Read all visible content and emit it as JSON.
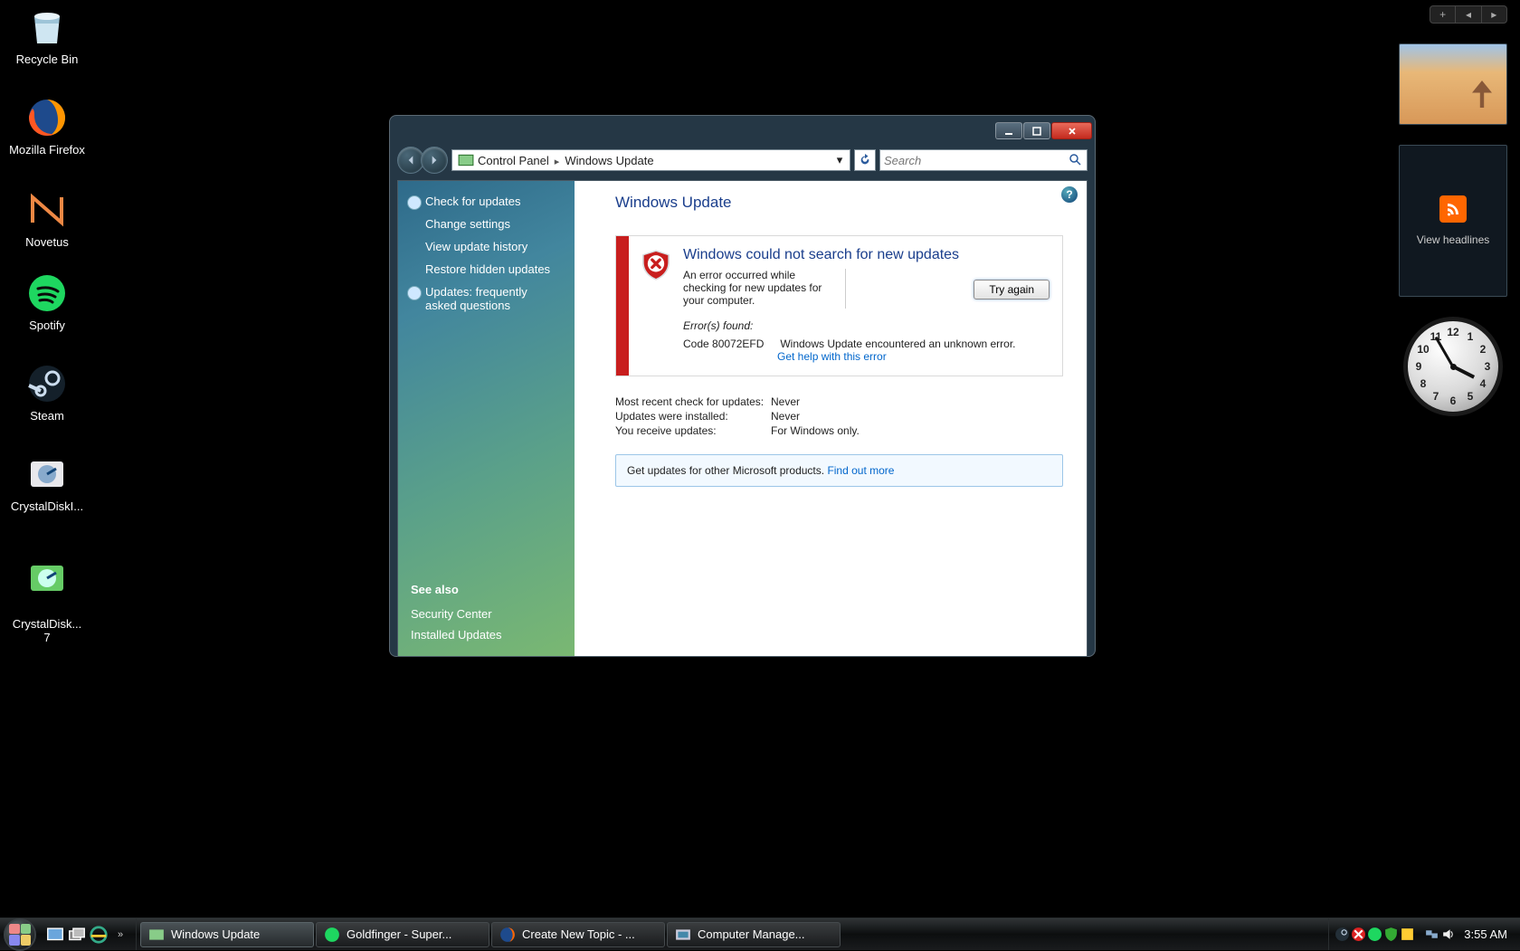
{
  "desktop_icons": [
    {
      "id": "recycle-bin",
      "label": "Recycle Bin"
    },
    {
      "id": "firefox",
      "label": "Mozilla Firefox"
    },
    {
      "id": "novetus",
      "label": "Novetus"
    },
    {
      "id": "spotify",
      "label": "Spotify"
    },
    {
      "id": "steam",
      "label": "Steam"
    },
    {
      "id": "crystaldiskinfo",
      "label": "CrystalDiskI..."
    },
    {
      "id": "crystaldiskinfo7",
      "label": "CrystalDisk...\n7"
    }
  ],
  "window": {
    "breadcrumb": {
      "root": "Control Panel",
      "leaf": "Windows Update"
    },
    "search_placeholder": "Search",
    "sidebar": {
      "tasks": [
        {
          "id": "check",
          "label": "Check for updates",
          "icon": true
        },
        {
          "id": "change",
          "label": "Change settings",
          "icon": false
        },
        {
          "id": "history",
          "label": "View update history",
          "icon": false
        },
        {
          "id": "restore",
          "label": "Restore hidden updates",
          "icon": false
        },
        {
          "id": "faq",
          "label": "Updates: frequently asked questions",
          "icon": true
        }
      ],
      "see_also_heading": "See also",
      "see_also": [
        {
          "id": "security",
          "label": "Security Center"
        },
        {
          "id": "installed",
          "label": "Installed Updates"
        }
      ]
    },
    "main": {
      "heading": "Windows Update",
      "error_title": "Windows could not search for new updates",
      "error_desc": "An error occurred while checking for new updates for your computer.",
      "try_again": "Try again",
      "errors_found": "Error(s) found:",
      "error_code": "Code 80072EFD",
      "error_msg": "Windows Update encountered an unknown error.",
      "error_help": "Get help with this error",
      "status": [
        {
          "k": "Most recent check for updates:",
          "v": "Never"
        },
        {
          "k": "Updates were installed:",
          "v": "Never"
        },
        {
          "k": "You receive updates:",
          "v": "For Windows only."
        }
      ],
      "promo_text": "Get updates for other Microsoft products. ",
      "promo_link": "Find out more"
    }
  },
  "gadgets": {
    "feed_label": "View headlines"
  },
  "taskbar": {
    "tasks": [
      {
        "id": "wu",
        "label": "Windows Update",
        "active": true,
        "icon": "wu"
      },
      {
        "id": "spotify",
        "label": "Goldfinger - Super...",
        "active": false,
        "icon": "spotify"
      },
      {
        "id": "firefox",
        "label": "Create New Topic - ...",
        "active": false,
        "icon": "firefox"
      },
      {
        "id": "compmgmt",
        "label": "Computer Manage...",
        "active": false,
        "icon": "compmgmt"
      }
    ],
    "clock": "3:55 AM"
  }
}
